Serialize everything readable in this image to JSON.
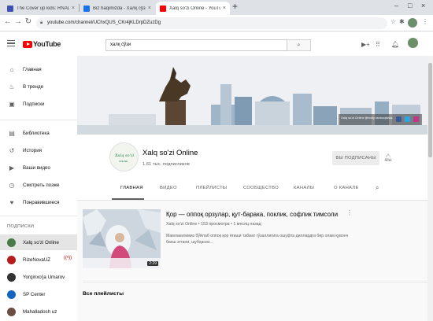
{
  "browser": {
    "tabs": [
      {
        "title": "The Cover up kids: RNAL - ",
        "favicon_color": "#3f51b5"
      },
      {
        "title": "Biz haqimizda - Халқ сўзи",
        "favicon_color": "#1a73e8"
      },
      {
        "title": "Xalq so'zi Online - YouTube",
        "favicon_color": "#ff0000"
      }
    ],
    "new_tab_glyph": "+",
    "url": "youtube.com/channel/UChxQUS_CKr4jKLDrpDZuzDg"
  },
  "masthead": {
    "logo_text": "YouTube",
    "search_value": "халқ сўзи"
  },
  "sidebar": {
    "items": [
      {
        "label": "Главная",
        "icon": "home-icon",
        "glyph": "⌂"
      },
      {
        "label": "В тренде",
        "icon": "trending-icon",
        "glyph": "♨"
      },
      {
        "label": "Подписки",
        "icon": "subscriptions-icon",
        "glyph": "▣"
      },
      {
        "label": "Библиотека",
        "icon": "library-icon",
        "glyph": "▤"
      },
      {
        "label": "История",
        "icon": "history-icon",
        "glyph": "↺"
      },
      {
        "label": "Ваши видео",
        "icon": "your-videos-icon",
        "glyph": "▶"
      },
      {
        "label": "Смотреть позже",
        "icon": "watch-later-icon",
        "glyph": "◷"
      },
      {
        "label": "Понравившиеся",
        "icon": "liked-icon",
        "glyph": "♥"
      }
    ],
    "subscriptions_heading": "ПОДПИСКИ",
    "subscriptions": [
      {
        "label": "Xalq so'zi Online",
        "color": "#4a7a4a"
      },
      {
        "label": "RizeNovaUZ",
        "color": "#b71c1c"
      },
      {
        "label": "Yorqinxo'ja Umarov",
        "color": "#333333"
      },
      {
        "label": "SP Center",
        "color": "#1565c0"
      },
      {
        "label": "Mahalladosh uz",
        "color": "#6d4c41"
      }
    ]
  },
  "banner": {
    "social_text": "Xalq so'zi Online ijtimoiy tarmoqlarda"
  },
  "channel": {
    "avatar_text": "Xalq so'zi",
    "avatar_sub": "ONLINE",
    "name": "Xalq so'zi Online",
    "subscribers": "1,61 тыс. подписчиков",
    "subscribed_label": "ВЫ ПОДПИСАНЫ",
    "tabs": [
      "ГЛАВНАЯ",
      "ВИДЕО",
      "ПЛЕЙЛИСТЫ",
      "СООБЩЕСТВО",
      "КАНАЛЫ",
      "О КАНАЛЕ"
    ]
  },
  "featured": {
    "title": "Қор — оппоқ орзулар, қут-барака, поклик, софлик тимсоли",
    "meta": "Xalq so'zi Online • 153 просмотра • 1 месяц назад",
    "description": "Мамлакатимиз бўйлаб оппоқ қор ёғиши табиат гўзаллигига ошуфта диллардга бир олам қувонч бахш этгани, шубҳасиз...",
    "duration": "2:29"
  },
  "sections": {
    "playlists_title": "Все плейлисты"
  },
  "colors": {
    "brand_red": "#ff0000",
    "active_item_bg": "#e5e5e5"
  }
}
